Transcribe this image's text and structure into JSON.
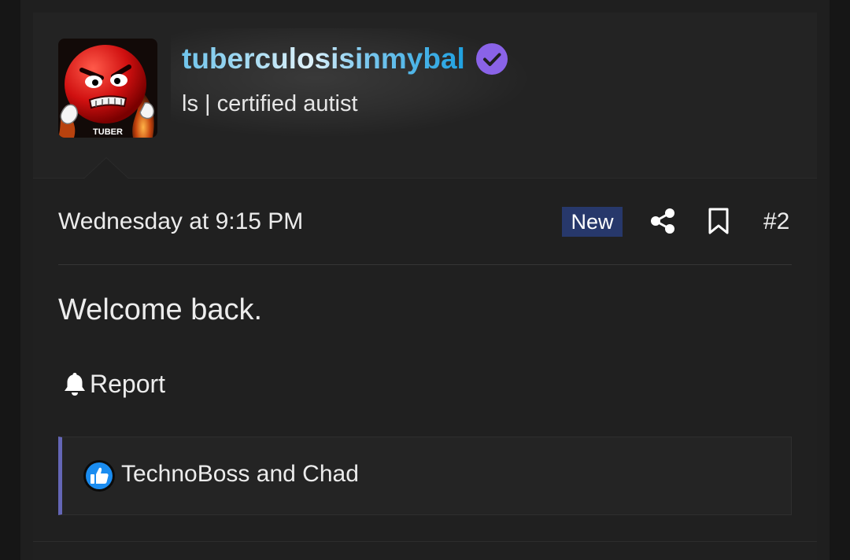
{
  "post": {
    "author": {
      "username": "tuberculosisinmybal",
      "user_title": "ls | certified autist",
      "avatar_caption": "TUBER",
      "verified_icon": "verified-check-icon"
    },
    "date": "Wednesday at 9:15 PM",
    "new_badge": "New",
    "post_number": "#2",
    "body": "Welcome back.",
    "report_label": "Report",
    "reactions_text": "TechnoBoss and Chad",
    "colors": {
      "new_badge_bg": "#27386b",
      "verified_badge": "#8a63e8",
      "reactions_accent": "#6466b6",
      "like_icon": "#1a8cf0"
    }
  }
}
